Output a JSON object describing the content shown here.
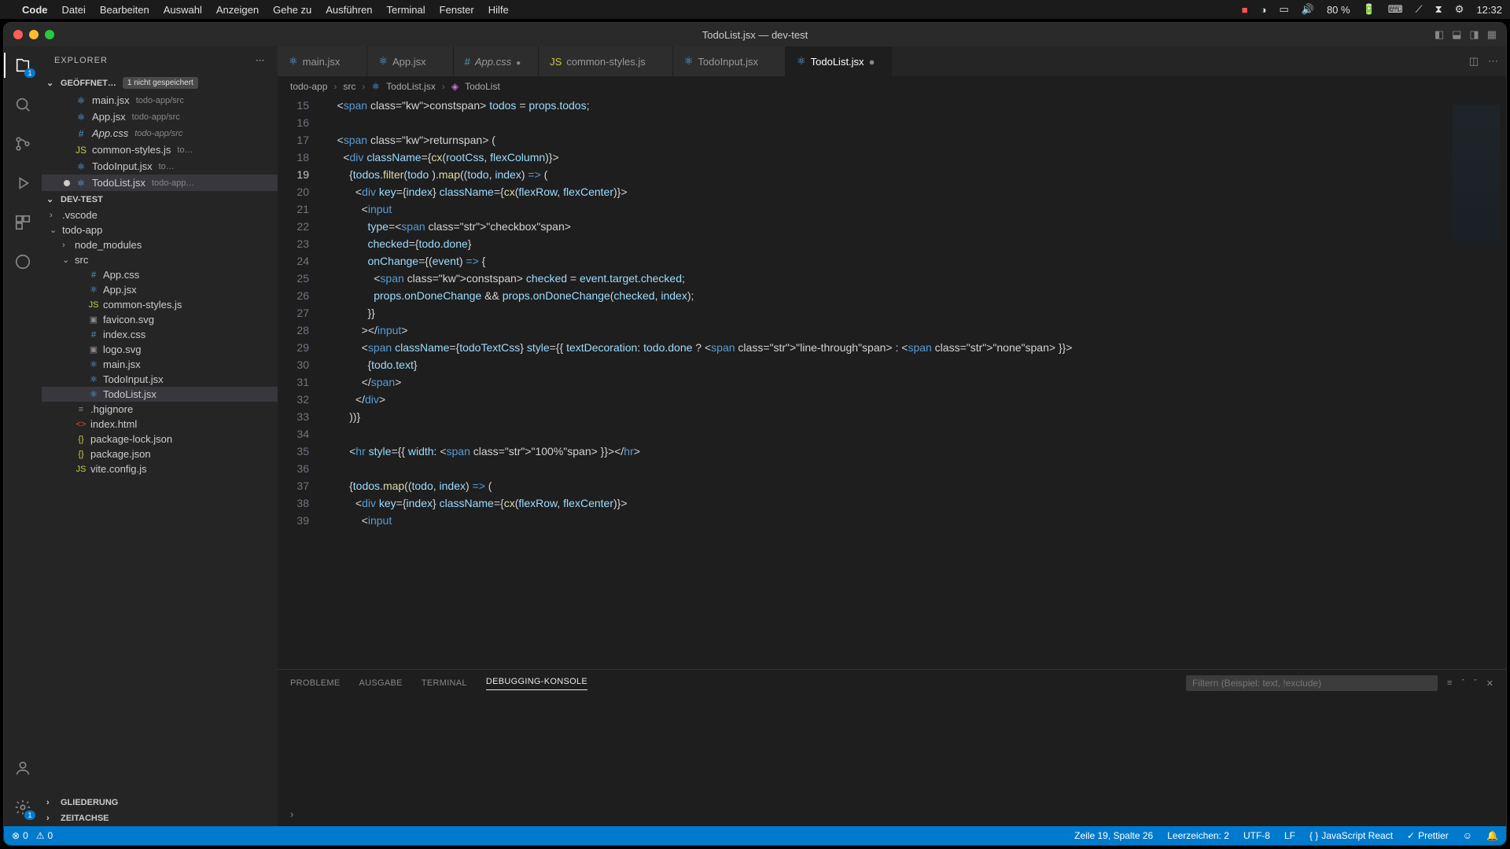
{
  "menubar": {
    "app": "Code",
    "items": [
      "Datei",
      "Bearbeiten",
      "Auswahl",
      "Anzeigen",
      "Gehe zu",
      "Ausführen",
      "Terminal",
      "Fenster",
      "Hilfe"
    ],
    "battery": "80 %",
    "time": "12:32"
  },
  "window": {
    "title": "TodoList.jsx — dev-test"
  },
  "sidebar": {
    "title": "EXPLORER",
    "open_editors_label": "GEÖFFNET…",
    "unsaved_badge": "1 nicht gespeichert",
    "open_editors": [
      {
        "name": "main.jsx",
        "path": "todo-app/src",
        "icon": "⚛"
      },
      {
        "name": "App.jsx",
        "path": "todo-app/src",
        "icon": "⚛"
      },
      {
        "name": "App.css",
        "path": "todo-app/src",
        "icon": "#",
        "modified": true
      },
      {
        "name": "common-styles.js",
        "path": "to…",
        "icon": "JS"
      },
      {
        "name": "TodoInput.jsx",
        "path": "to…",
        "icon": "⚛"
      },
      {
        "name": "TodoList.jsx",
        "path": "todo-app…",
        "icon": "⚛",
        "dirty": true,
        "selected": true
      }
    ],
    "project": "DEV-TEST",
    "tree": [
      {
        "name": ".vscode",
        "indent": 0,
        "icon": "›",
        "type": "folder"
      },
      {
        "name": "todo-app",
        "indent": 0,
        "icon": "⌄",
        "type": "folder"
      },
      {
        "name": "node_modules",
        "indent": 1,
        "icon": "›",
        "type": "folder"
      },
      {
        "name": "src",
        "indent": 1,
        "icon": "⌄",
        "type": "folder"
      },
      {
        "name": "App.css",
        "indent": 2,
        "icon": "#",
        "type": "file"
      },
      {
        "name": "App.jsx",
        "indent": 2,
        "icon": "⚛",
        "type": "file"
      },
      {
        "name": "common-styles.js",
        "indent": 2,
        "icon": "JS",
        "type": "file"
      },
      {
        "name": "favicon.svg",
        "indent": 2,
        "icon": "▣",
        "type": "file"
      },
      {
        "name": "index.css",
        "indent": 2,
        "icon": "#",
        "type": "file"
      },
      {
        "name": "logo.svg",
        "indent": 2,
        "icon": "▣",
        "type": "file"
      },
      {
        "name": "main.jsx",
        "indent": 2,
        "icon": "⚛",
        "type": "file"
      },
      {
        "name": "TodoInput.jsx",
        "indent": 2,
        "icon": "⚛",
        "type": "file"
      },
      {
        "name": "TodoList.jsx",
        "indent": 2,
        "icon": "⚛",
        "type": "file",
        "selected": true
      },
      {
        "name": ".hgignore",
        "indent": 1,
        "icon": "≡",
        "type": "file"
      },
      {
        "name": "index.html",
        "indent": 1,
        "icon": "<>",
        "type": "file"
      },
      {
        "name": "package-lock.json",
        "indent": 1,
        "icon": "{}",
        "type": "file"
      },
      {
        "name": "package.json",
        "indent": 1,
        "icon": "{}",
        "type": "file"
      },
      {
        "name": "vite.config.js",
        "indent": 1,
        "icon": "JS",
        "type": "file"
      }
    ],
    "outline": "GLIEDERUNG",
    "timeline": "ZEITACHSE"
  },
  "tabs": [
    {
      "name": "main.jsx",
      "icon": "⚛"
    },
    {
      "name": "App.jsx",
      "icon": "⚛"
    },
    {
      "name": "App.css",
      "icon": "#",
      "modified": true
    },
    {
      "name": "common-styles.js",
      "icon": "JS"
    },
    {
      "name": "TodoInput.jsx",
      "icon": "⚛"
    },
    {
      "name": "TodoList.jsx",
      "icon": "⚛",
      "active": true,
      "dirty": true
    }
  ],
  "breadcrumb": [
    "todo-app",
    "src",
    "TodoList.jsx",
    "TodoList"
  ],
  "code": {
    "first_line_no": 15,
    "current_line": 19,
    "lines": [
      "    const todos = props.todos;",
      "",
      "    return (",
      "      <div className={cx(rootCss, flexColumn)}>",
      "        {todos.filter(todo ).map((todo, index) => (",
      "          <div key={index} className={cx(flexRow, flexCenter)}>",
      "            <input",
      "              type=\"checkbox\"",
      "              checked={todo.done}",
      "              onChange={(event) => {",
      "                const checked = event.target.checked;",
      "                props.onDoneChange && props.onDoneChange(checked, index);",
      "              }}",
      "            ></input>",
      "            <span className={todoTextCss} style={{ textDecoration: todo.done ? \"line-through\" : \"none\" }}>",
      "              {todo.text}",
      "            </span>",
      "          </div>",
      "        ))}",
      "",
      "        <hr style={{ width: \"100%\" }}></hr>",
      "",
      "        {todos.map((todo, index) => (",
      "          <div key={index} className={cx(flexRow, flexCenter)}>",
      "            <input"
    ]
  },
  "panel": {
    "tabs": [
      "PROBLEME",
      "AUSGABE",
      "TERMINAL",
      "DEBUGGING-KONSOLE"
    ],
    "active": 3,
    "filter_placeholder": "Filtern (Beispiel: text, !exclude)"
  },
  "statusbar": {
    "errors": "0",
    "warnings": "0",
    "cursor": "Zeile 19, Spalte 26",
    "indent": "Leerzeichen: 2",
    "encoding": "UTF-8",
    "eol": "LF",
    "lang": "JavaScript React",
    "prettier": "Prettier"
  },
  "activity_badge": "1"
}
